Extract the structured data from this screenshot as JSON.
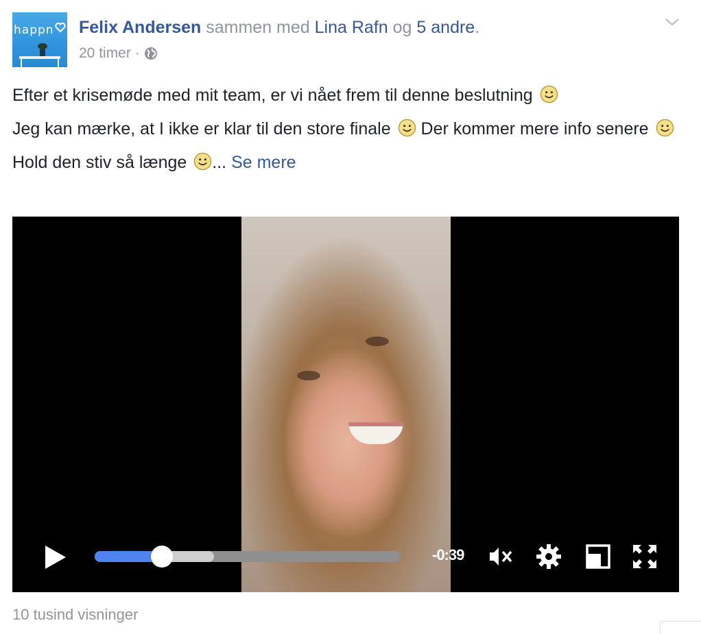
{
  "author": {
    "avatar_brand_text": "happn",
    "name": "Felix Andersen",
    "with_text": "sammen med",
    "tagged": "Lina Rafn",
    "and_text": "og",
    "others": "5 andre",
    "period": "."
  },
  "meta": {
    "time": "20 timer",
    "separator": "·",
    "privacy_icon": "globe-icon"
  },
  "post": {
    "line1": "Efter et krisemøde med mit team, er vi nået frem til denne beslutning",
    "line2a": "Jeg kan mærke, at I ikke er klar til den store finale",
    "line2b": "Der kommer mere info senere",
    "line3": "Hold den stiv så længe",
    "ellipsis": "...",
    "see_more": "Se mere"
  },
  "video": {
    "time_remaining": "-0:39",
    "progress": 0.22,
    "buffered": 0.39,
    "icons": [
      "play-icon",
      "mute-icon",
      "settings-gear-icon",
      "minimize-icon",
      "fullscreen-icon"
    ]
  },
  "footer": {
    "views": "10 tusind visninger"
  },
  "colors": {
    "link": "#365899",
    "muted": "#90949c",
    "progress": "#4e83f0"
  }
}
